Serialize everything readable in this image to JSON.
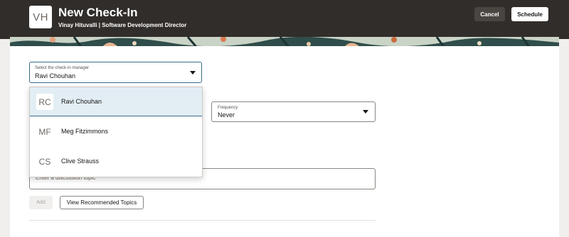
{
  "header": {
    "avatar_initials": "VH",
    "title": "New Check-In",
    "subtitle": "Vinay Hituvalli | Software Development Director",
    "cancel_label": "Cancel",
    "schedule_label": "Schedule"
  },
  "manager_select": {
    "label": "Select the check-in manager",
    "value": "Ravi Chouhan"
  },
  "frequency_select": {
    "label": "Frequency",
    "value": "Never"
  },
  "topic": {
    "placeholder": "Enter a discussion topic"
  },
  "actions": {
    "add_label": "Add",
    "recommended_label": "View Recommended Topics"
  },
  "dropdown": {
    "options": [
      {
        "initials": "RC",
        "name": "Ravi Chouhan",
        "selected": true
      },
      {
        "initials": "MF",
        "name": "Meg Fitzimmons",
        "selected": false
      },
      {
        "initials": "CS",
        "name": "Clive Strauss",
        "selected": false
      }
    ]
  },
  "colors": {
    "header_bg": "#312d2a",
    "focus_border": "#356b8a",
    "selected_row": "#e2eef4"
  }
}
